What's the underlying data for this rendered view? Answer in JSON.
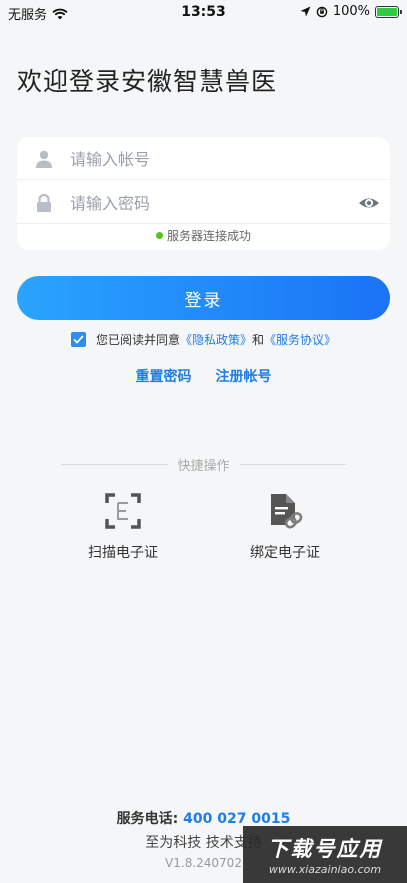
{
  "status_bar": {
    "carrier": "无服务",
    "time": "13:53",
    "battery": "100%"
  },
  "title": "欢迎登录安徽智慧兽医",
  "form": {
    "username_placeholder": "请输入帐号",
    "password_placeholder": "请输入密码",
    "connection_status": "服务器连接成功"
  },
  "login_button": "登录",
  "agreement": {
    "prefix": "您已阅读并同意",
    "privacy": "《隐私政策》",
    "and": "和",
    "service": "《服务协议》",
    "checked": true
  },
  "links": {
    "reset_password": "重置密码",
    "register": "注册帐号"
  },
  "quick": {
    "header": "快捷操作",
    "scan_label": "扫描电子证",
    "bind_label": "绑定电子证"
  },
  "footer": {
    "phone_label": "服务电话:",
    "phone": "400 027 0015",
    "company": "至为科技 技术支持",
    "version": "V1.8.240702"
  },
  "watermark": {
    "text": "下载号应用",
    "url": "www.xiazainiao.com"
  },
  "colors": {
    "accent": "#1e7ee6",
    "button_start": "#2aa4ff",
    "button_end": "#1a73f5",
    "success": "#52c41a"
  }
}
